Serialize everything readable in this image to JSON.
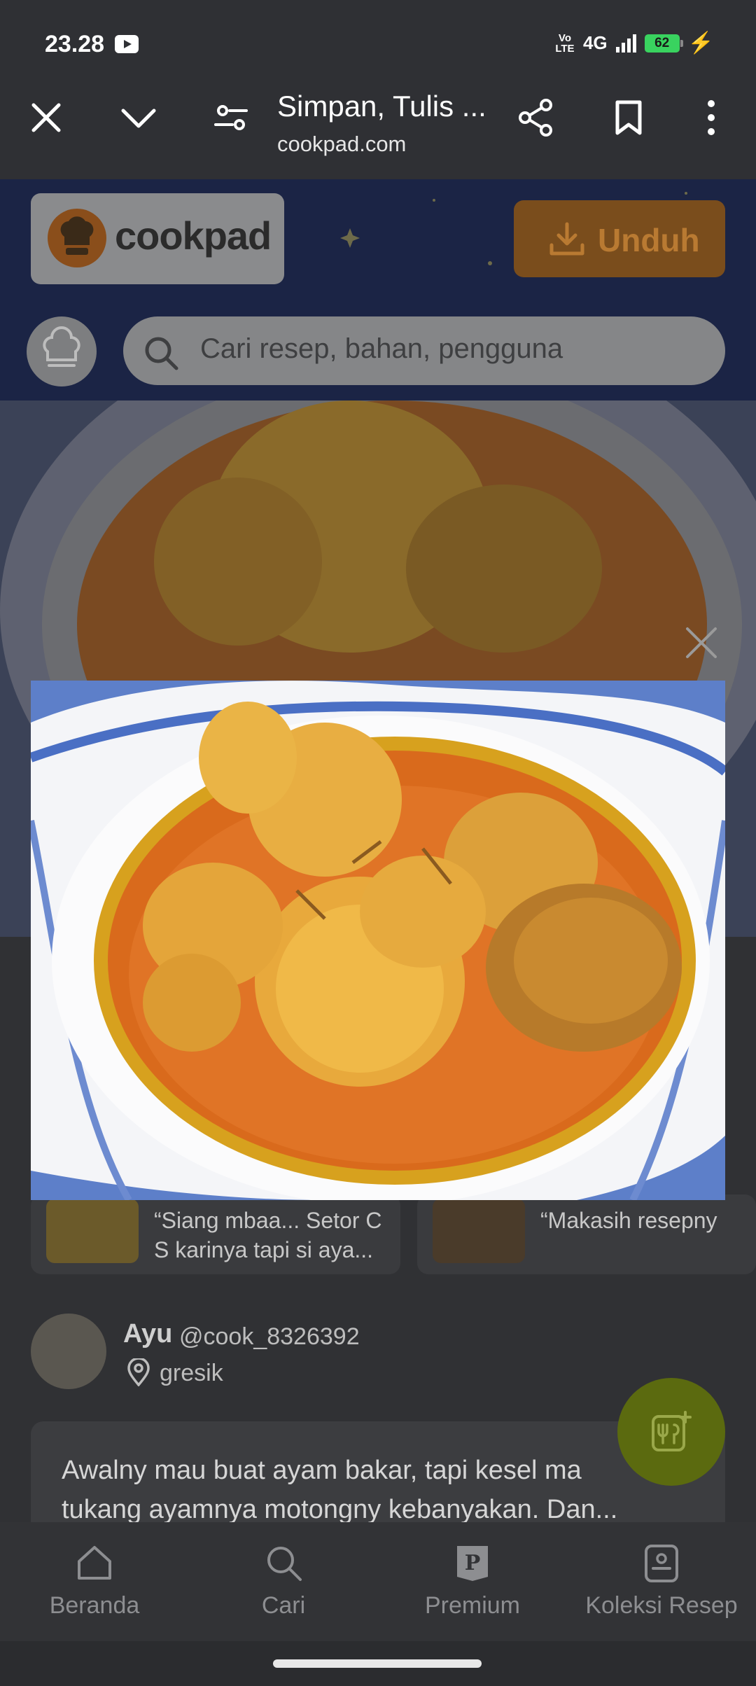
{
  "status_bar": {
    "time": "23.28",
    "network_type": "4G",
    "volte": "Vo LTE",
    "battery": "62"
  },
  "browser": {
    "title": "Simpan, Tulis ...",
    "url": "cookpad.com"
  },
  "site": {
    "logo_text": "cookpad",
    "download_label": "Unduh",
    "search_placeholder": "Cari resep, bahan, pengguna"
  },
  "comments": [
    {
      "text_line1": "“Siang mbaa... Setor C",
      "text_line2": "S karinya tapi si aya..."
    },
    {
      "text_line1": "“Makasih resepny",
      "text_line2": ""
    }
  ],
  "author": {
    "name": "Ayu",
    "handle": "@cook_8326392",
    "location": "gresik"
  },
  "story": {
    "text": "Awalny mau buat ayam bakar, tapi kesel ma tukang ayamnya motongny kebanyakan. Dan..."
  },
  "bottom_nav": [
    {
      "label": "Beranda"
    },
    {
      "label": "Cari"
    },
    {
      "label": "Premium"
    },
    {
      "label": "Koleksi Resep"
    }
  ],
  "colors": {
    "accent_orange": "#f39c2b",
    "fab_green": "#6d8a0b"
  }
}
